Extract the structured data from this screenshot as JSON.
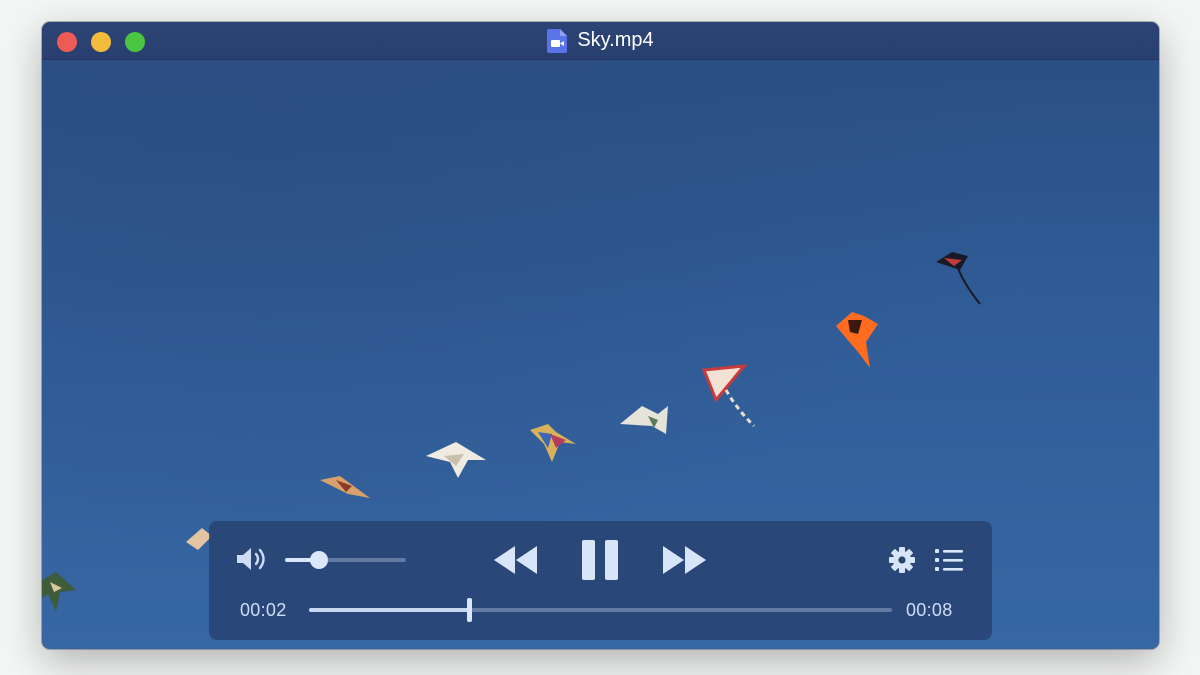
{
  "window": {
    "title": "Sky.mp4",
    "file_icon": "video-file-icon"
  },
  "player": {
    "volume_icon": "speaker-icon",
    "volume_level": 0.28,
    "current_time": "00:02",
    "total_time": "00:08",
    "progress": 0.275,
    "controls": {
      "rewind_icon": "rewind-icon",
      "pause_icon": "pause-icon",
      "forward_icon": "fast-forward-icon",
      "settings_icon": "gear-icon",
      "playlist_icon": "list-icon"
    }
  },
  "colors": {
    "accent_light": "#dbe6f8",
    "control_bg": "#284473",
    "sky": "#305d98"
  }
}
